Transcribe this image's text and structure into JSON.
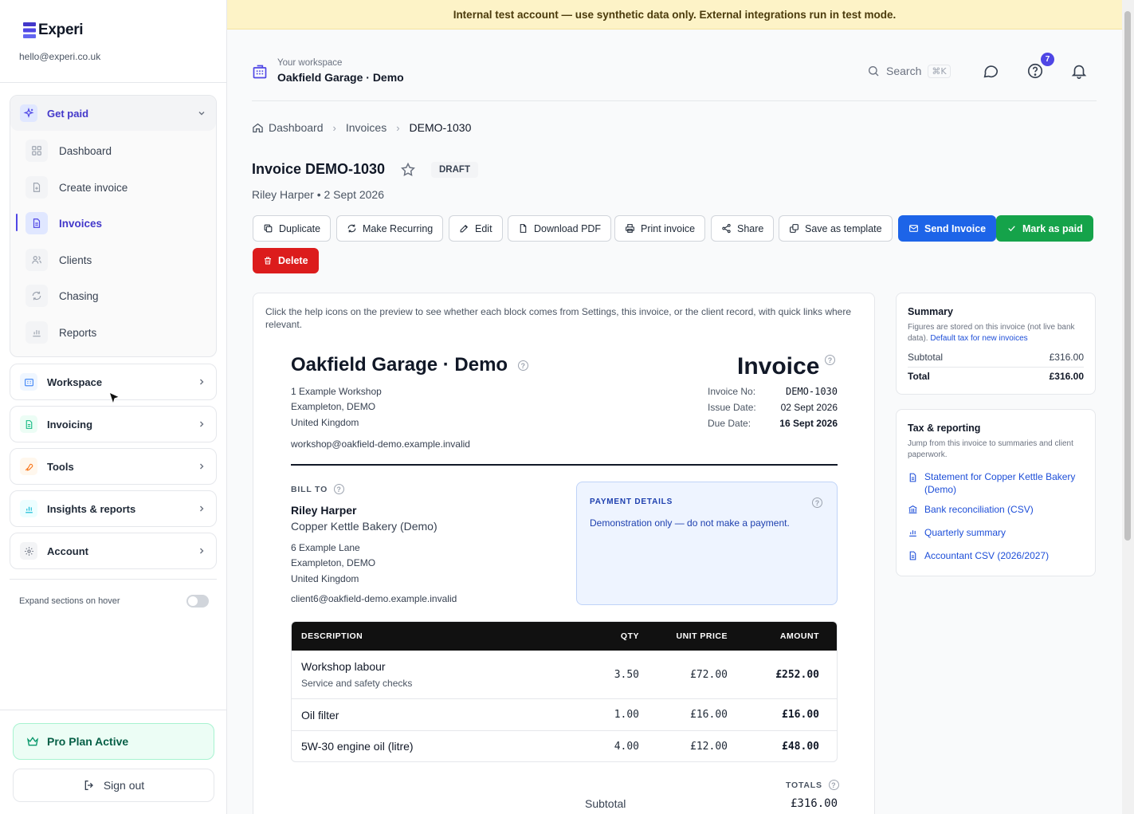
{
  "app": {
    "brand": "Experi",
    "email": "hello@experi.co.uk"
  },
  "banner": "Internal test account — use synthetic data only. External integrations run in test mode.",
  "sidebar": {
    "open_group": {
      "label": "Get paid",
      "icon": "sparkle-icon"
    },
    "items": [
      {
        "label": "Dashboard",
        "icon": "grid-icon"
      },
      {
        "label": "Create invoice",
        "icon": "file-plus-icon"
      },
      {
        "label": "Invoices",
        "icon": "document-icon",
        "active": true
      },
      {
        "label": "Clients",
        "icon": "users-icon"
      },
      {
        "label": "Chasing",
        "icon": "refresh-icon"
      },
      {
        "label": "Reports",
        "icon": "bar-chart-icon"
      }
    ],
    "groups": [
      {
        "label": "Workspace",
        "icon": "building-icon"
      },
      {
        "label": "Invoicing",
        "icon": "file-icon"
      },
      {
        "label": "Tools",
        "icon": "wrench-icon"
      },
      {
        "label": "Insights & reports",
        "icon": "chart-icon"
      },
      {
        "label": "Account",
        "icon": "gear-icon"
      }
    ],
    "expand_toggle_label": "Expand sections on hover",
    "expand_toggle_on": false,
    "plan": "Pro Plan Active",
    "sign_out": "Sign out"
  },
  "topbar": {
    "workspace_label": "Your workspace",
    "workspace_name": "Oakfield Garage · Demo",
    "search_placeholder": "Search",
    "search_shortcut": "⌘K",
    "help_badge": "7"
  },
  "breadcrumb": [
    "Dashboard",
    "Invoices",
    "DEMO-1030"
  ],
  "invoice": {
    "title": "Invoice DEMO-1030",
    "status": "DRAFT",
    "subline": "Riley Harper • 2 Sept 2026"
  },
  "actions": {
    "duplicate": "Duplicate",
    "recurring": "Make Recurring",
    "edit": "Edit",
    "download": "Download PDF",
    "print": "Print invoice",
    "share": "Share",
    "template": "Save as template",
    "send": "Send Invoice",
    "mark_paid": "Mark as paid",
    "delete": "Delete"
  },
  "preview": {
    "help_note": "Click the help icons on the preview to see whether each block comes from Settings, this invoice, or the client record, with quick links where relevant.",
    "business_name": "Oakfield Garage · Demo",
    "business_address": [
      "1 Example Workshop",
      "Exampleton, DEMO",
      "United Kingdom"
    ],
    "business_email": "workshop@oakfield-demo.example.invalid",
    "doc_title": "Invoice",
    "meta": {
      "number_label": "Invoice No:",
      "number": "DEMO-1030",
      "issue_label": "Issue Date:",
      "issue": "02 Sept 2026",
      "due_label": "Due Date:",
      "due": "16 Sept 2026"
    },
    "bill_to_label": "BILL TO",
    "client_name": "Riley Harper",
    "client_company": "Copper Kettle Bakery (Demo)",
    "client_address": [
      "6 Example Lane",
      "Exampleton, DEMO",
      "United Kingdom"
    ],
    "client_email": "client6@oakfield-demo.example.invalid",
    "payment_title": "PAYMENT DETAILS",
    "payment_text": "Demonstration only — do not make a payment.",
    "columns": {
      "desc": "DESCRIPTION",
      "qty": "QTY",
      "unit": "UNIT PRICE",
      "amount": "AMOUNT"
    },
    "lines": [
      {
        "desc": "Workshop labour",
        "sub": "Service and safety checks",
        "qty": "3.50",
        "unit": "£72.00",
        "amount": "£252.00"
      },
      {
        "desc": "Oil filter",
        "sub": "",
        "qty": "1.00",
        "unit": "£16.00",
        "amount": "£16.00"
      },
      {
        "desc": "5W-30 engine oil (litre)",
        "sub": "",
        "qty": "4.00",
        "unit": "£12.00",
        "amount": "£48.00"
      }
    ],
    "totals_label": "TOTALS",
    "subtotal_label": "Subtotal",
    "subtotal": "£316.00"
  },
  "summary": {
    "title": "Summary",
    "desc": "Figures are stored on this invoice (not live bank data).",
    "desc_link": "Default tax for new invoices",
    "subtotal_label": "Subtotal",
    "subtotal": "£316.00",
    "total_label": "Total",
    "total": "£316.00"
  },
  "tax": {
    "title": "Tax & reporting",
    "desc": "Jump from this invoice to summaries and client paperwork.",
    "links": [
      {
        "label": "Statement for Copper Kettle Bakery (Demo)",
        "icon": "document-icon"
      },
      {
        "label": "Bank reconciliation (CSV)",
        "icon": "bank-icon"
      },
      {
        "label": "Quarterly summary",
        "icon": "bar-chart-icon"
      },
      {
        "label": "Accountant CSV (2026/2027)",
        "icon": "document-icon"
      }
    ]
  }
}
